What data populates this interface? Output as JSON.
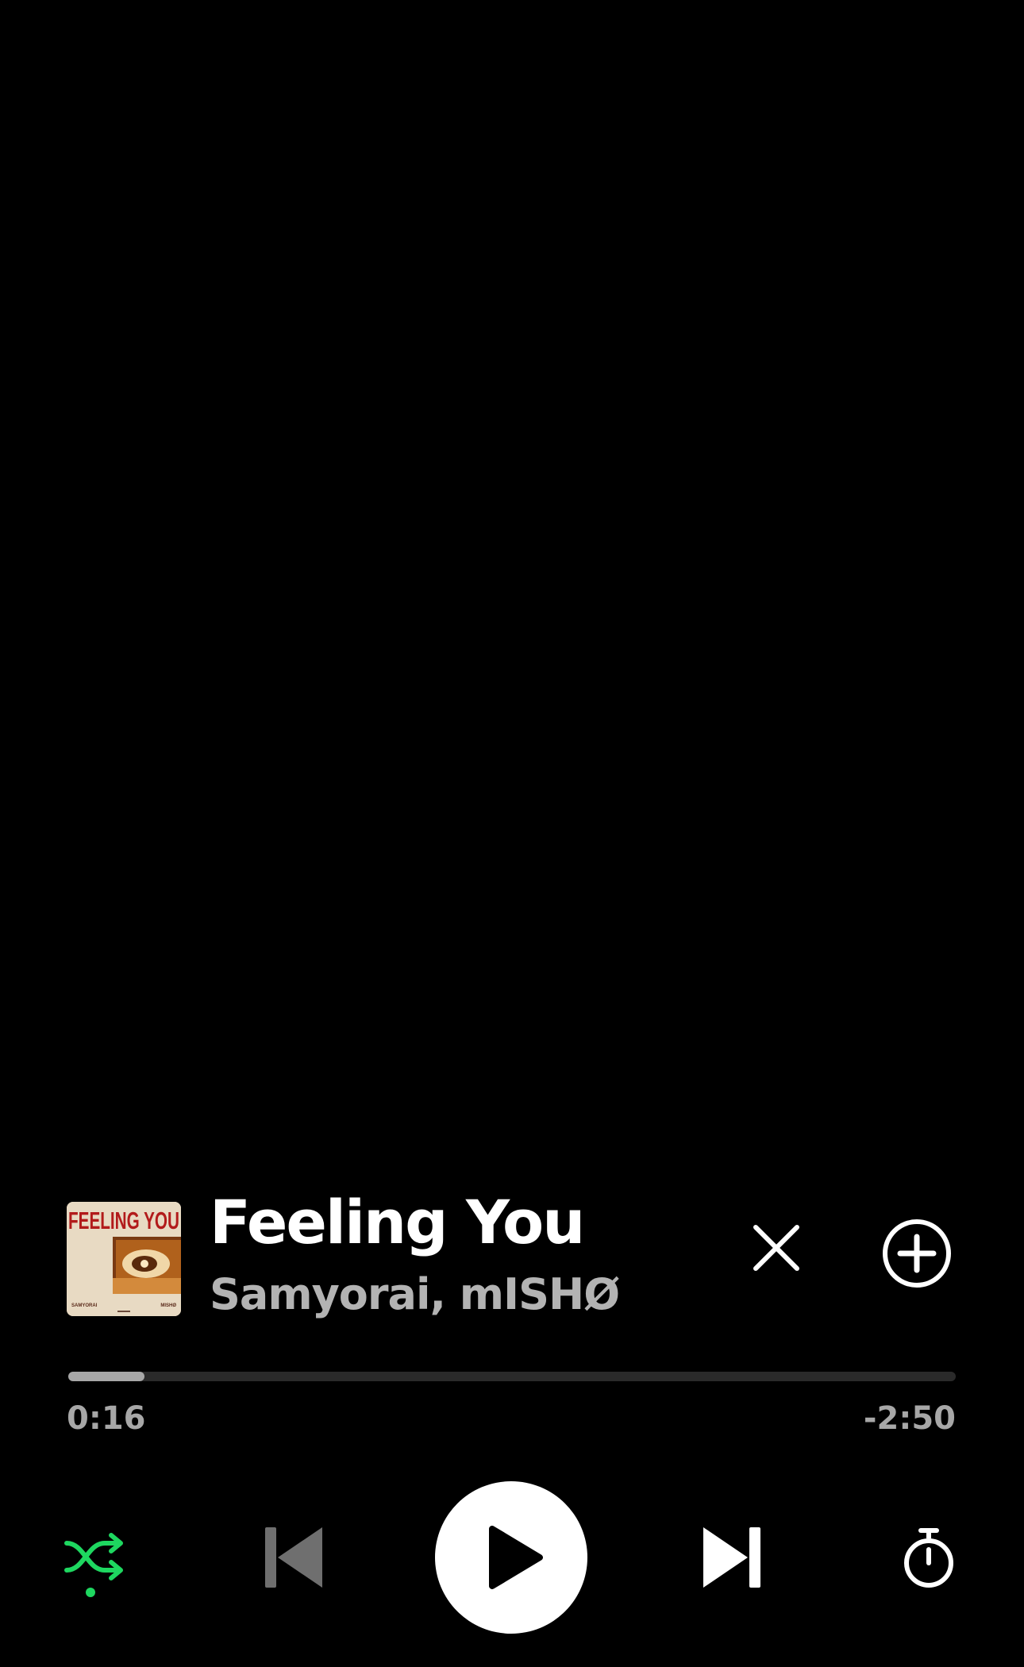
{
  "track": {
    "title": "Feeling You",
    "artists": "Samyorai, mISHØ",
    "album_art_text": {
      "headline": "FEELING YOU",
      "left_credit": "SAMYORAI",
      "right_credit": "MISHØ"
    }
  },
  "playback": {
    "elapsed": "0:16",
    "remaining": "-2:50",
    "progress_fraction": 0.0857,
    "is_playing": false
  },
  "controls": {
    "shuffle_icon": "shuffle-icon",
    "shuffle_active": true,
    "previous_icon": "skip-previous-icon",
    "previous_enabled": false,
    "play_icon": "play-icon",
    "next_icon": "skip-next-icon",
    "timer_icon": "sleep-timer-icon",
    "close_icon": "close-icon",
    "add_icon": "add-circle-icon"
  },
  "colors": {
    "background": "#000000",
    "accent_green": "#1ed760",
    "primary_text": "#ffffff",
    "secondary_text": "#b3b3b3",
    "disabled": "#6f6f6f",
    "track_bg": "#2a2a2a"
  }
}
